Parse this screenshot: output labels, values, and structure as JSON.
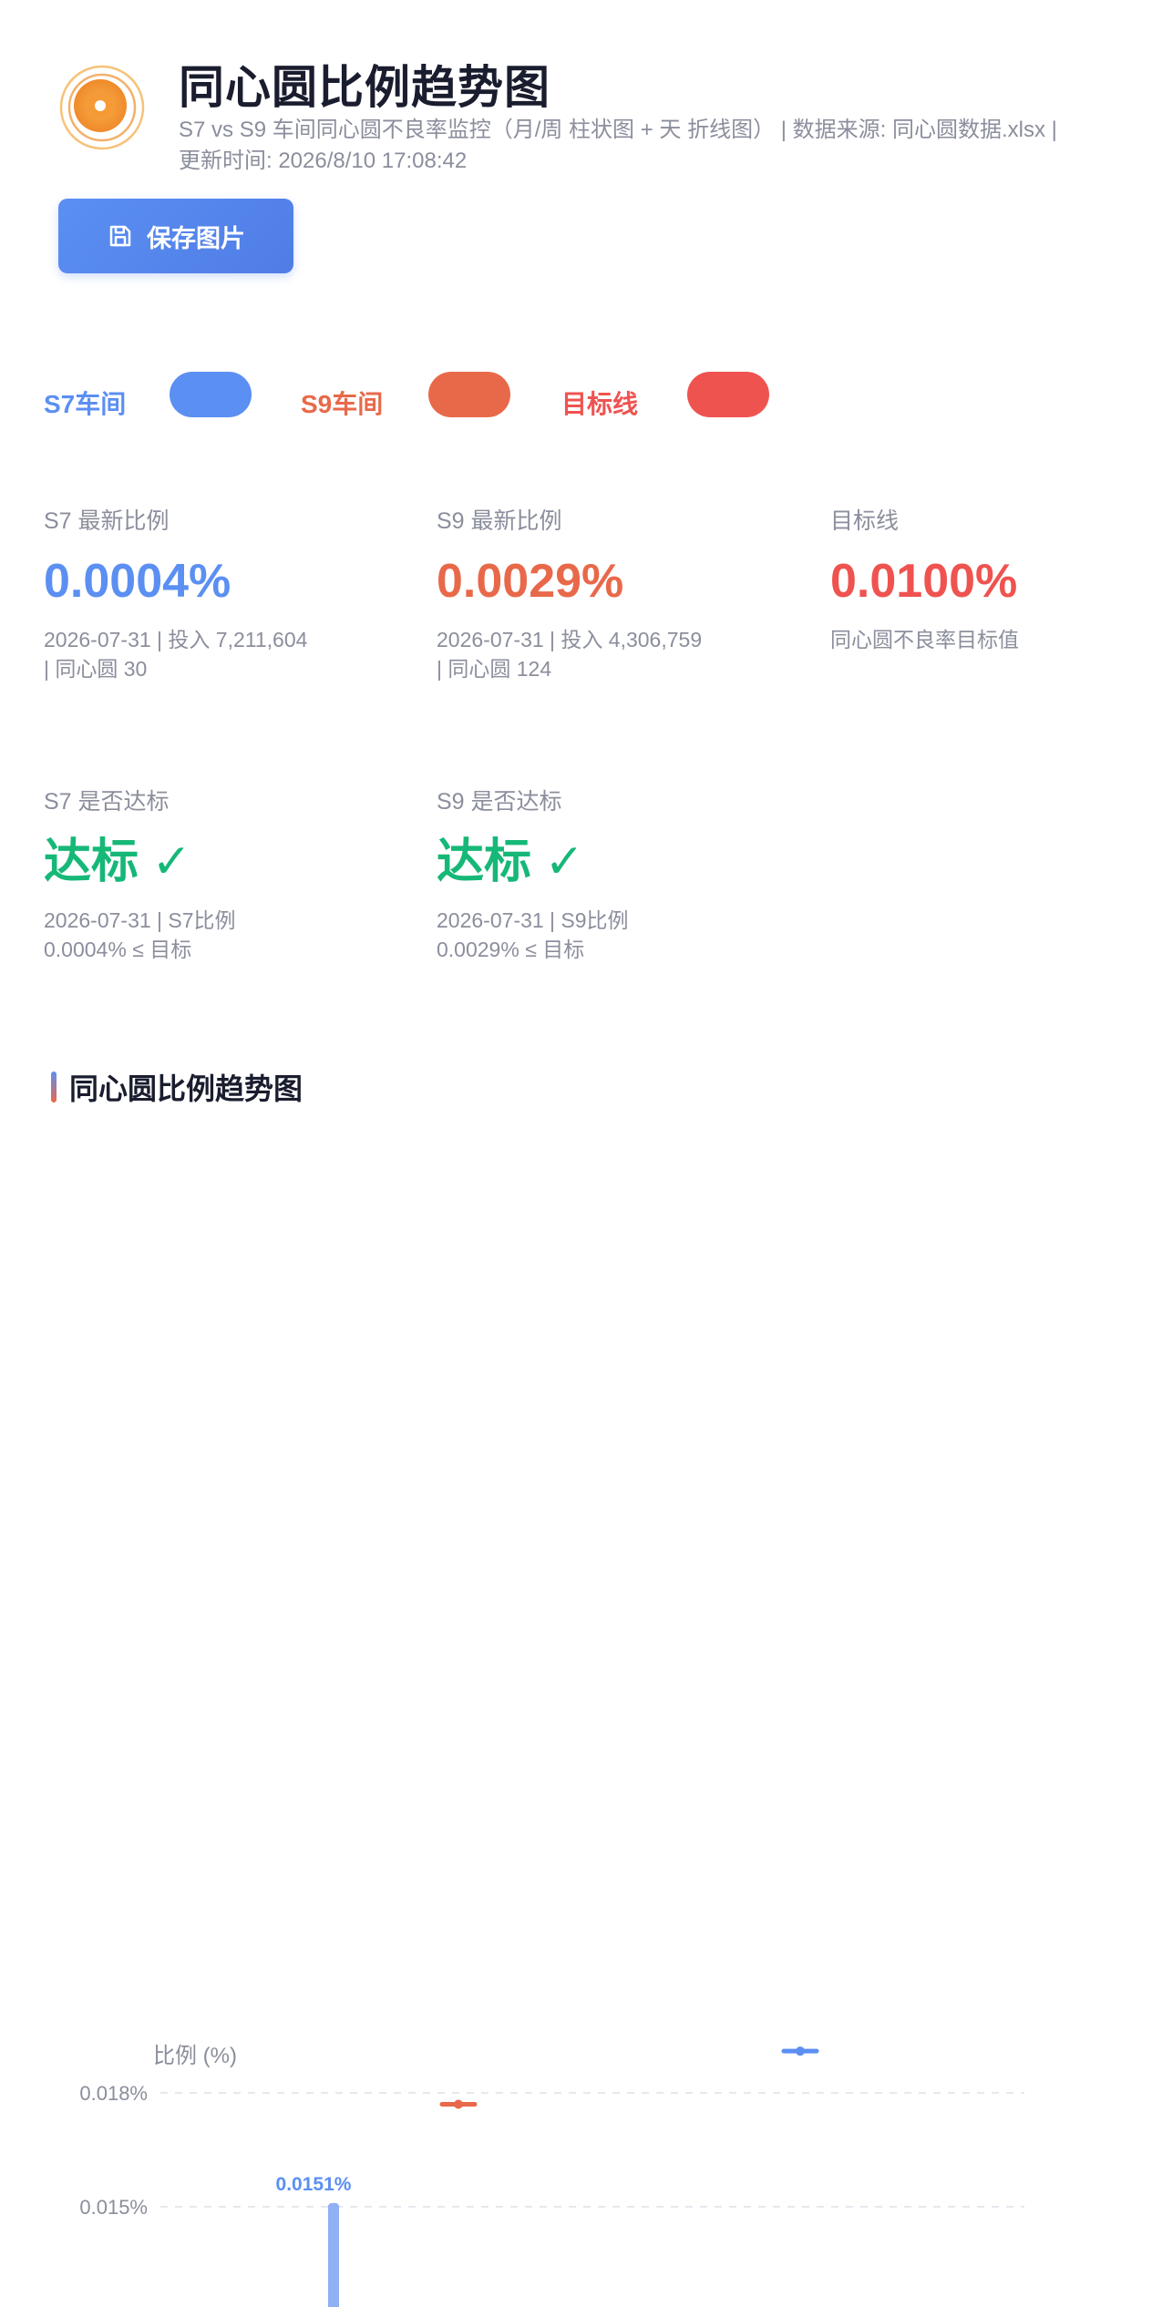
{
  "header": {
    "title": "同心圆比例趋势图",
    "subtitle": "S7 vs S9 车间同心圆不良率监控（月/周 柱状图 + 天 折线图） | 数据来源: 同心圆数据.xlsx | 更新时间: 2026/8/10 17:08:42",
    "logo_icon": "concentric-circle-logo",
    "save_label": "保存图片",
    "save_icon": "save-icon"
  },
  "legend": [
    {
      "label": "S7车间",
      "color": "#5b8ff2"
    },
    {
      "label": "S9车间",
      "color": "#e8694a"
    },
    {
      "label": "目标线",
      "color": "#ef5350"
    }
  ],
  "kpis": [
    {
      "label": "S7 最新比例",
      "value": "0.0004%",
      "note1": "2026-07-31 | 投入 7,211,604",
      "note2": "| 同心圆 30",
      "color": "#5b8ff2"
    },
    {
      "label": "S9 最新比例",
      "value": "0.0029%",
      "note1": "2026-07-31 | 投入 4,306,759",
      "note2": "| 同心圆 124",
      "color": "#e8694a"
    },
    {
      "label": "目标线",
      "value": "0.0100%",
      "note1": "同心圆不良率目标值",
      "note2": "",
      "color": "#ef5350"
    },
    {
      "label": "S7 是否达标",
      "value": "达标 ✓",
      "note1": "2026-07-31 | S7比例",
      "note2": "0.0004% ≤ 目标",
      "color": "#16b877"
    },
    {
      "label": "S9 是否达标",
      "value": "达标 ✓",
      "note1": "2026-07-31 | S9比例",
      "note2": "0.0029% ≤ 目标",
      "color": "#16b877"
    }
  ],
  "section": {
    "title": "同心圆比例趋势图"
  },
  "chart_data": {
    "type": "bar",
    "ylabel": "比例 (%)",
    "y_ticks": [
      "0.018%",
      "0.015%"
    ],
    "ylim": [
      0,
      0.02
    ],
    "bar_label": "0.0151%",
    "bars": [
      {
        "series": "S7车间",
        "value": 0.0151
      }
    ],
    "markers": [
      {
        "series": "S7车间",
        "value": 0.0191
      },
      {
        "series": "S9车间",
        "value": 0.0177
      }
    ]
  }
}
